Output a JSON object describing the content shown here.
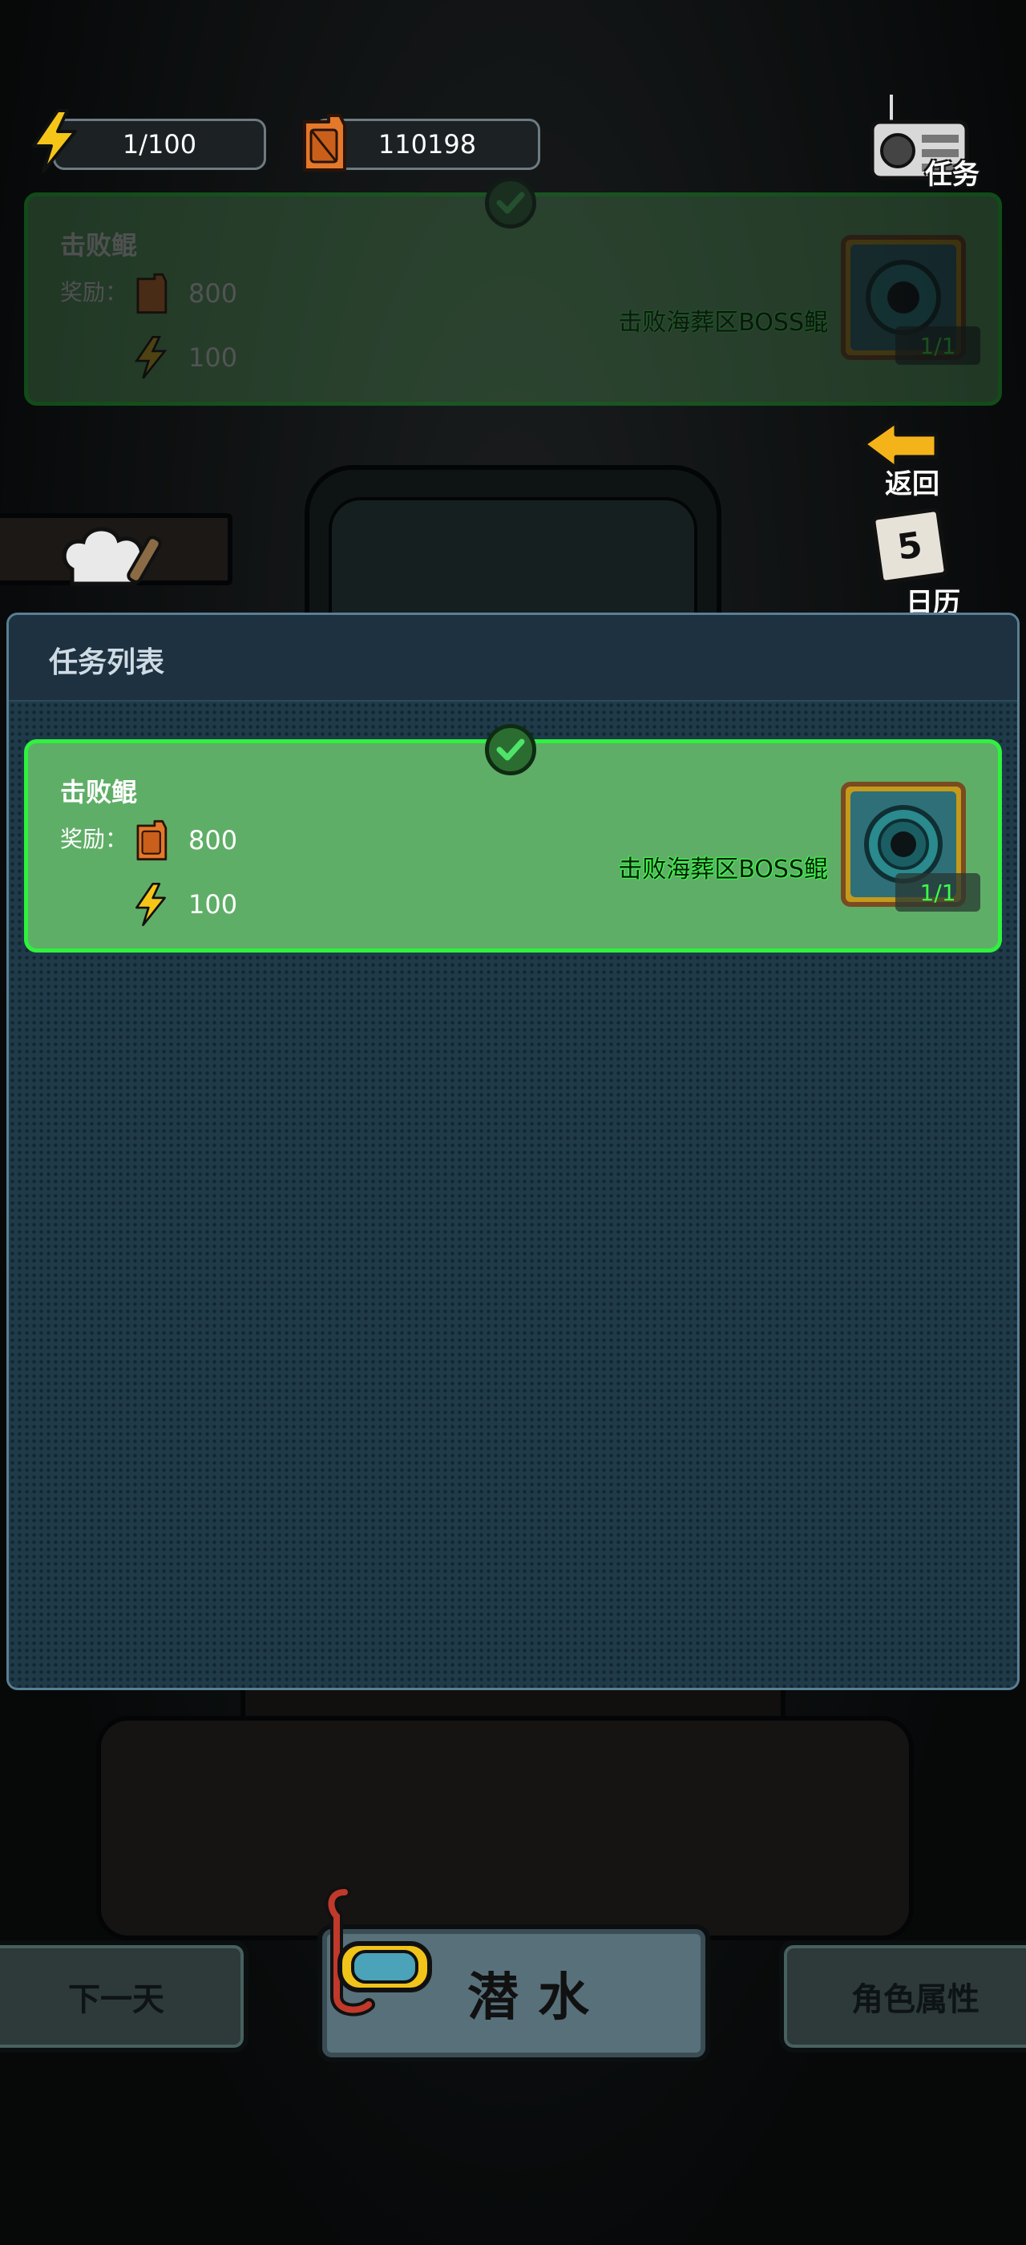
{
  "hud": {
    "energy": "1/100",
    "fuel": "110198"
  },
  "corner": {
    "task_label": "任务",
    "back_label": "返回",
    "calendar_day": "5",
    "calendar_label": "日历",
    "kitchen_label": "厨房"
  },
  "panel": {
    "title": "任务列表"
  },
  "task": {
    "title": "击败鲲",
    "reward_label": "奖励：",
    "fuel_reward": "800",
    "energy_reward": "100",
    "description": "击败海葬区BOSS鲲",
    "progress": "1/1",
    "completed": true
  },
  "bottom": {
    "next_day": "下一天",
    "dive": "潜水",
    "attributes": "角色属性"
  },
  "colors": {
    "task_bg": "#5fae67",
    "task_border": "#2ef23d",
    "panel_bg": "#1c3544",
    "accent_yellow": "#f5c518"
  }
}
